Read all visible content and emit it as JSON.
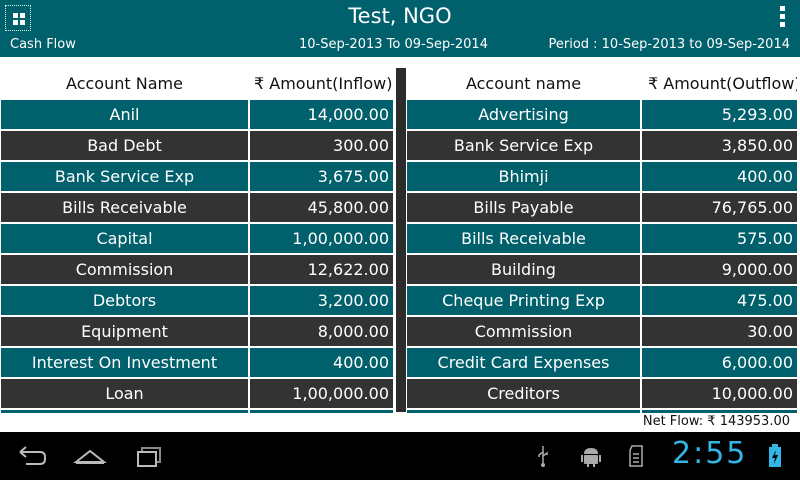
{
  "header": {
    "title": "Test, NGO",
    "report_name": "Cash Flow",
    "date_range": "10-Sep-2013 To 09-Sep-2014",
    "period": "Period : 10-Sep-2013 to 09-Sep-2014"
  },
  "inflow": {
    "col_name": "Account Name",
    "col_amount": "₹ Amount(Inflow)",
    "rows": [
      {
        "name": "Anil",
        "amount": "14,000.00"
      },
      {
        "name": "Bad Debt",
        "amount": "300.00"
      },
      {
        "name": "Bank Service Exp",
        "amount": "3,675.00"
      },
      {
        "name": "Bills Receivable",
        "amount": "45,800.00"
      },
      {
        "name": "Capital",
        "amount": "1,00,000.00"
      },
      {
        "name": "Commission",
        "amount": "12,622.00"
      },
      {
        "name": "Debtors",
        "amount": "3,200.00"
      },
      {
        "name": "Equipment",
        "amount": "8,000.00"
      },
      {
        "name": "Interest On Investment",
        "amount": "400.00"
      },
      {
        "name": "Loan",
        "amount": "1,00,000.00"
      }
    ]
  },
  "outflow": {
    "col_name": "Account name",
    "col_amount": "₹ Amount(Outflow)",
    "rows": [
      {
        "name": "Advertising",
        "amount": "5,293.00"
      },
      {
        "name": "Bank Service Exp",
        "amount": "3,850.00"
      },
      {
        "name": "Bhimji",
        "amount": "400.00"
      },
      {
        "name": "Bills Payable",
        "amount": "76,765.00"
      },
      {
        "name": "Bills Receivable",
        "amount": "575.00"
      },
      {
        "name": "Building",
        "amount": "9,000.00"
      },
      {
        "name": "Cheque Printing Exp",
        "amount": "475.00"
      },
      {
        "name": "Commission",
        "amount": "30.00"
      },
      {
        "name": "Credit Card Expenses",
        "amount": "6,000.00"
      },
      {
        "name": "Creditors",
        "amount": "10,000.00"
      }
    ]
  },
  "net_flow": "Net Flow: ₹ 143953.00",
  "status": {
    "clock": "2:55",
    "icons": [
      "usb-icon",
      "android-debug-icon",
      "sd-card-icon",
      "battery-charging-icon"
    ]
  },
  "nav": {
    "icons": [
      "back-icon",
      "home-icon",
      "recent-apps-icon"
    ]
  },
  "colors": {
    "teal": "#00606b",
    "dark_row": "#333333",
    "clock": "#33b5e5"
  }
}
